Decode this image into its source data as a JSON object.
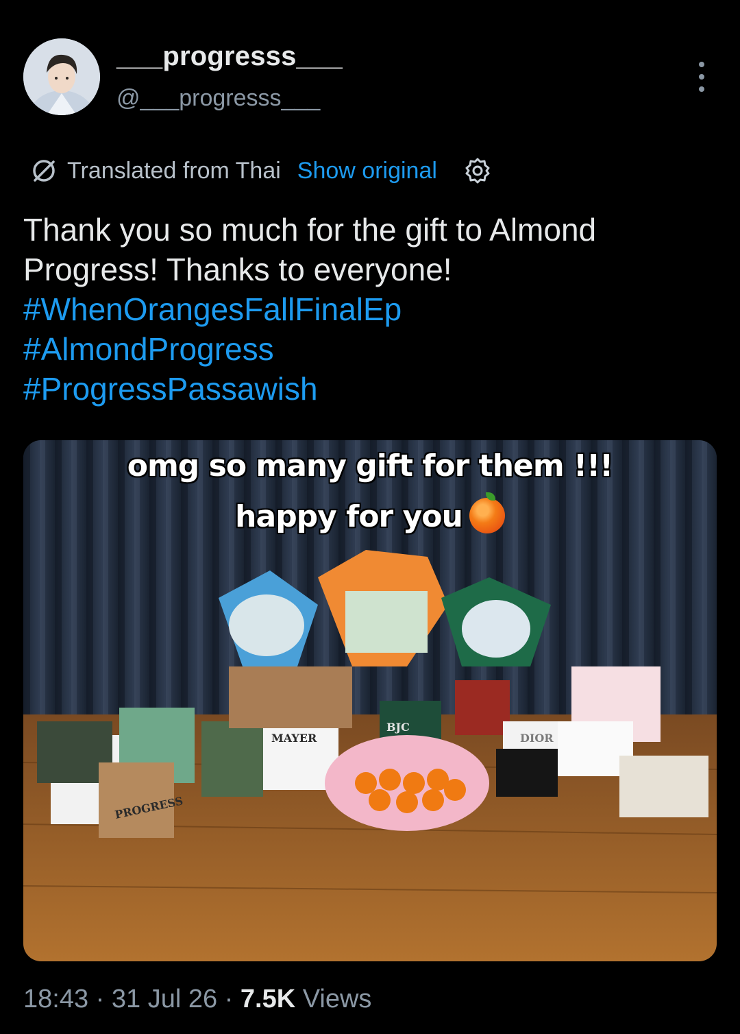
{
  "author": {
    "display_name": "___progresss___",
    "handle": "@___progresss___"
  },
  "translation": {
    "label": "Translated from Thai",
    "show_original": "Show original"
  },
  "tweet": {
    "text_lines": [
      "Thank you so much for the gift to Almond",
      "Progress! Thanks to everyone!"
    ],
    "hashtags": [
      "#WhenOrangesFallFinalEp",
      "#AlmondProgress",
      "#ProgressPassawish"
    ]
  },
  "media": {
    "caption_line1": "omg so many gift for them !!!",
    "caption_line2": "happy for you",
    "caption_emoji": "orange-emoji",
    "bag_labels": [
      "PROGRESS",
      "MAYER",
      "BJC",
      "DIOR"
    ]
  },
  "meta": {
    "time": "18:43",
    "date": "31 Jul 26",
    "separator": "·",
    "views_count": "7.5K",
    "views_label": "Views"
  },
  "icons": {
    "more": "more-vertical-icon",
    "translate": "translate-icon",
    "settings": "gear-icon"
  },
  "colors": {
    "background": "#000000",
    "link": "#1d9bf0",
    "text": "#e7e9ea",
    "secondary": "#8b98a5"
  }
}
